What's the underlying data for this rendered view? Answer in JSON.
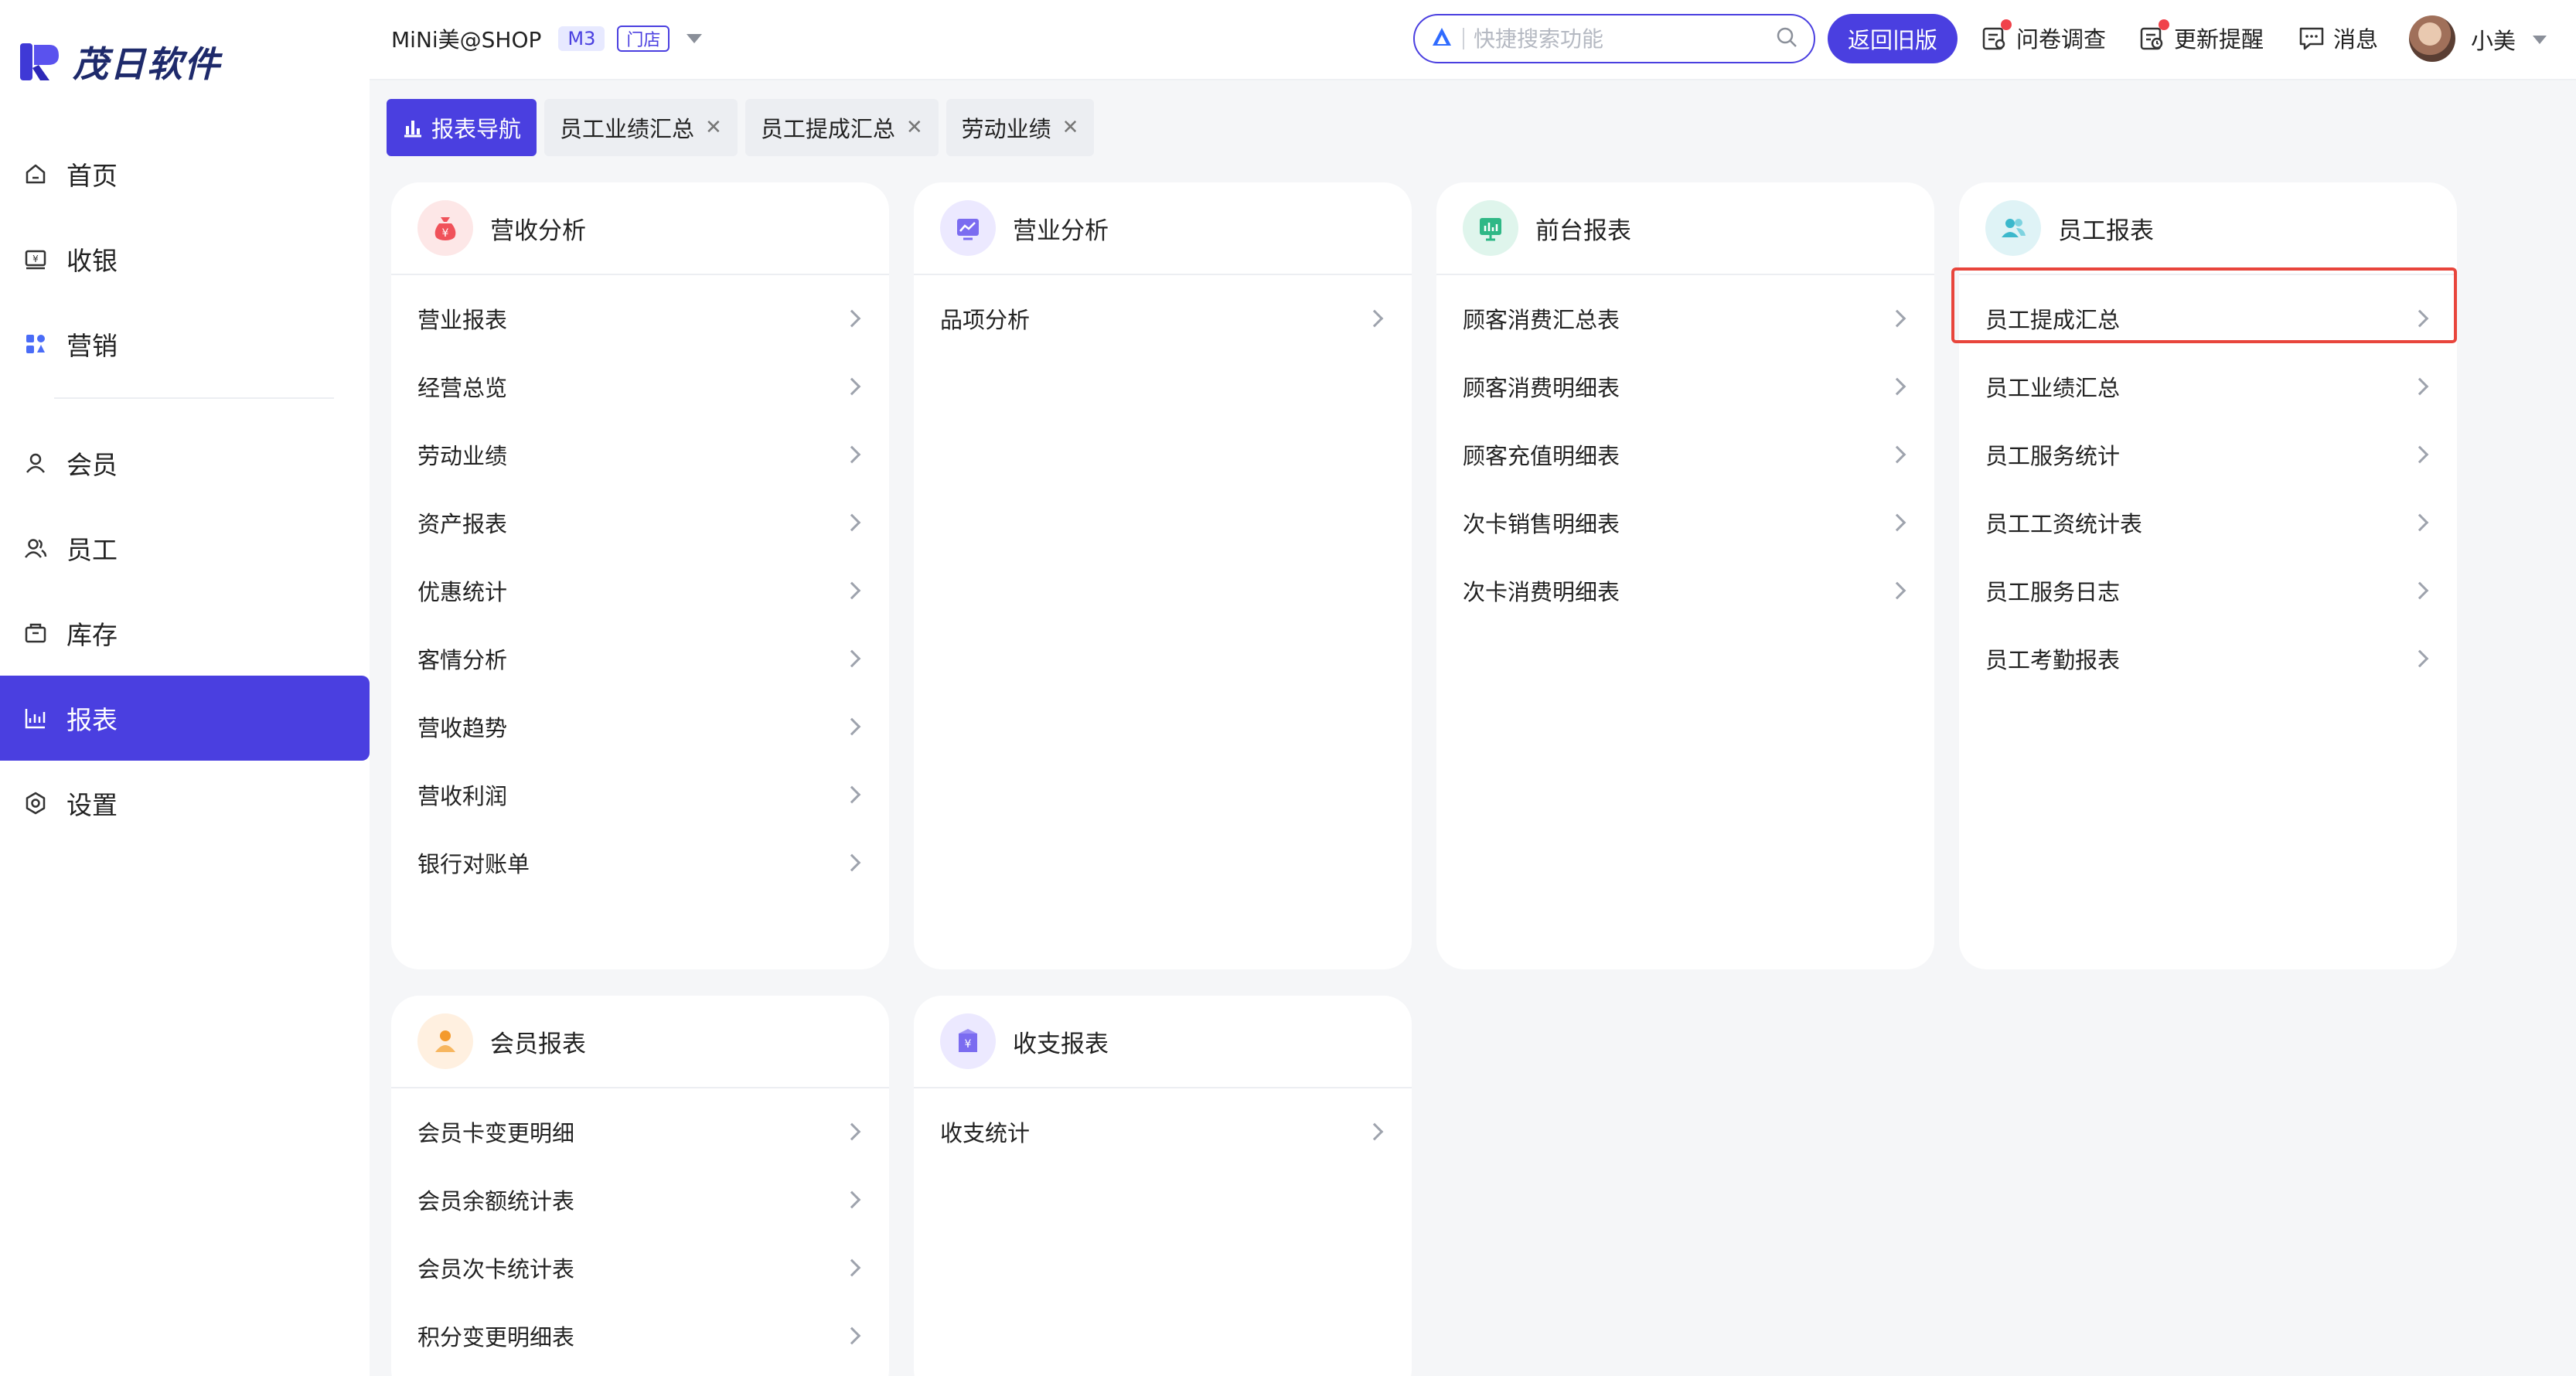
{
  "app": {
    "logo_text": "茂日软件"
  },
  "sidebar": {
    "items": [
      {
        "label": "首页",
        "icon": "home-icon"
      },
      {
        "label": "收银",
        "icon": "cashier-icon"
      },
      {
        "label": "营销",
        "icon": "marketing-icon"
      },
      {
        "label": "会员",
        "icon": "member-icon"
      },
      {
        "label": "员工",
        "icon": "staff-icon"
      },
      {
        "label": "库存",
        "icon": "inventory-icon"
      },
      {
        "label": "报表",
        "icon": "report-icon",
        "active": true
      },
      {
        "label": "设置",
        "icon": "settings-icon"
      }
    ]
  },
  "header": {
    "store_name": "MiNi美@SHOP",
    "plan_badge": "M3",
    "store_badge": "门店",
    "search_placeholder": "快捷搜索功能",
    "old_version_button": "返回旧版",
    "survey_label": "问卷调查",
    "update_label": "更新提醒",
    "message_label": "消息",
    "user_name": "小美"
  },
  "tabs": [
    {
      "label": "报表导航",
      "active": true
    },
    {
      "label": "员工业绩汇总",
      "closable": true
    },
    {
      "label": "员工提成汇总",
      "closable": true
    },
    {
      "label": "劳动业绩",
      "closable": true
    }
  ],
  "cards": [
    {
      "title": "营收分析",
      "icon": "money-bag-icon",
      "icon_bg": "#fde7e7",
      "icon_color": "#f0525a",
      "items": [
        "营业报表",
        "经营总览",
        "劳动业绩",
        "资产报表",
        "优惠统计",
        "客情分析",
        "营收趋势",
        "营收利润",
        "银行对账单"
      ]
    },
    {
      "title": "营业分析",
      "icon": "trend-chart-icon",
      "icon_bg": "#ece9ff",
      "icon_color": "#7b6cf0",
      "items": [
        "品项分析"
      ]
    },
    {
      "title": "前台报表",
      "icon": "presentation-icon",
      "icon_bg": "#dff5ec",
      "icon_color": "#2fb886",
      "items": [
        "顾客消费汇总表",
        "顾客消费明细表",
        "顾客充值明细表",
        "次卡销售明细表",
        "次卡消费明细表"
      ]
    },
    {
      "title": "员工报表",
      "icon": "staff-group-icon",
      "icon_bg": "#dff3f6",
      "icon_color": "#3bb8cc",
      "items": [
        "员工提成汇总",
        "员工业绩汇总",
        "员工服务统计",
        "员工工资统计表",
        "员工服务日志",
        "员工考勤报表"
      ]
    },
    {
      "title": "会员报表",
      "icon": "member-person-icon",
      "icon_bg": "#fff0e0",
      "icon_color": "#f49a2c",
      "items": [
        "会员卡变更明细",
        "会员余额统计表",
        "会员次卡统计表",
        "积分变更明细表"
      ]
    },
    {
      "title": "收支报表",
      "icon": "wallet-icon",
      "icon_bg": "#ece9ff",
      "icon_color": "#7b6cf0",
      "items": [
        "收支统计"
      ]
    }
  ],
  "colors": {
    "accent": "#4a3fe0",
    "highlight": "#e8453c"
  }
}
